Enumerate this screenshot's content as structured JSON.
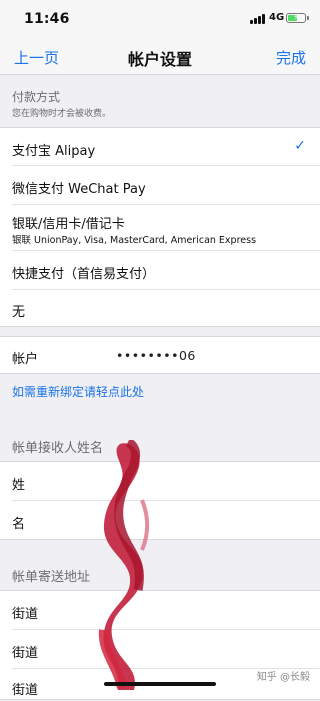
{
  "status_bar": {
    "time": "11:46",
    "network": "4G"
  },
  "nav": {
    "back_label": "上一页",
    "title": "帐户设置",
    "done_label": "完成"
  },
  "payment": {
    "header": "付款方式",
    "subheader": "您在购物时才会被收费。",
    "options": [
      {
        "label": "支付宝 Alipay",
        "selected": true
      },
      {
        "label": "微信支付 WeChat Pay"
      },
      {
        "label": "银联/信用卡/借记卡",
        "sub": "银联 UnionPay, Visa, MasterCard, American Express"
      },
      {
        "label": "快捷支付（首信易支付）"
      },
      {
        "label": "无"
      }
    ],
    "check_icon": "checkmark-icon"
  },
  "account": {
    "label": "帐户",
    "value": "••••••••06",
    "rebind_link": "如需重新绑定请轻点此处"
  },
  "billing_name": {
    "header": "帐单接收人姓名",
    "fields": [
      "姓",
      "名"
    ]
  },
  "billing_address": {
    "header": "帐单寄送地址",
    "fields": [
      "街道",
      "街道",
      "街道"
    ]
  },
  "watermark": "知乎 @长毅",
  "colors": {
    "accent": "#1a73e8",
    "background": "#efeff4",
    "battery": "#4cd964",
    "redaction": "#c21f3c"
  }
}
